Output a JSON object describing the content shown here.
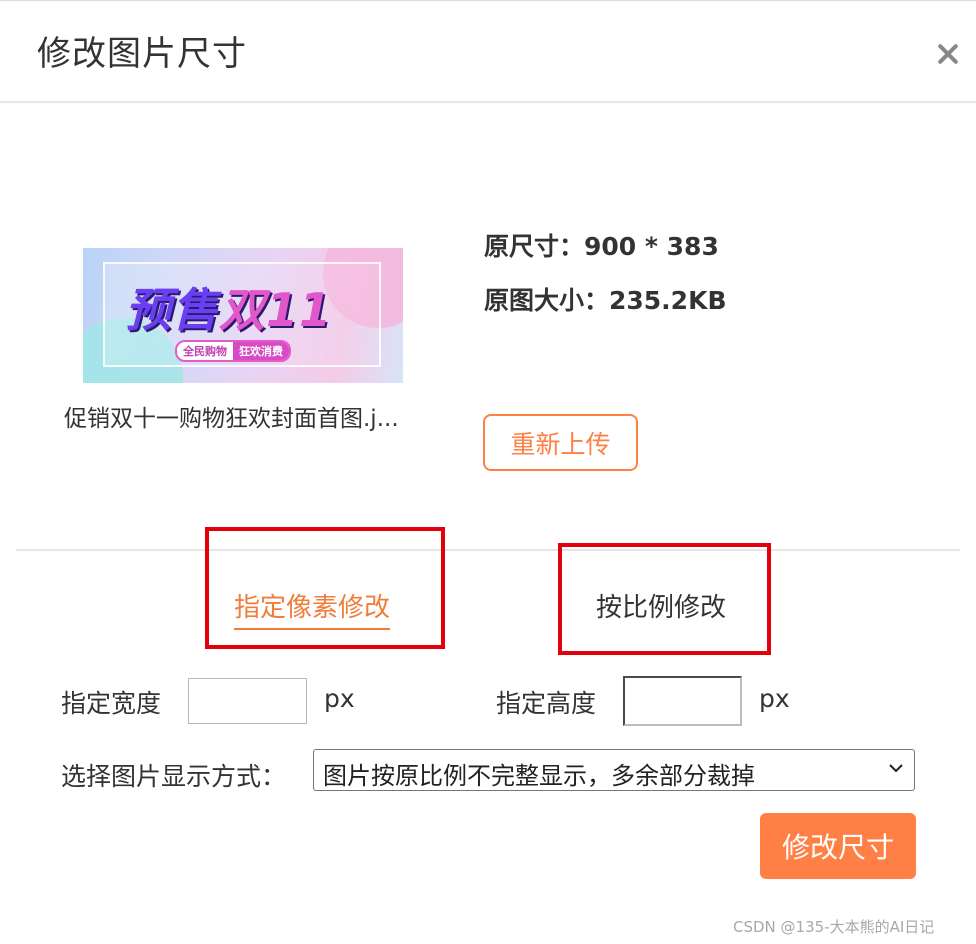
{
  "dialog": {
    "title": "修改图片尺寸"
  },
  "image": {
    "thumbnail_text_main": "预售",
    "thumbnail_text_accent": "双11",
    "thumbnail_tag_left": "全民购物",
    "thumbnail_tag_right": "狂欢消费",
    "filename": "促销双十一购物狂欢封面首图.j..."
  },
  "info": {
    "original_size": "原尺寸：900 * 383",
    "original_file_size": "原图大小：235.2KB"
  },
  "buttons": {
    "reupload": "重新上传",
    "submit": "修改尺寸"
  },
  "tabs": {
    "pixel": "指定像素修改",
    "ratio": "按比例修改",
    "active": "pixel"
  },
  "form": {
    "width_label": "指定宽度",
    "width_value": "",
    "width_unit": "px",
    "height_label": "指定高度",
    "height_value": "",
    "height_unit": "px",
    "display_mode_label": "选择图片显示方式：",
    "display_mode_value": "图片按原比例不完整显示，多余部分裁掉"
  },
  "watermark": "CSDN @135-大本熊的AI日记",
  "colors": {
    "accent": "#ff7f45",
    "highlight_box": "#e3000b"
  },
  "icons": {
    "close": "close-icon",
    "select": "chevron-down-icon"
  }
}
